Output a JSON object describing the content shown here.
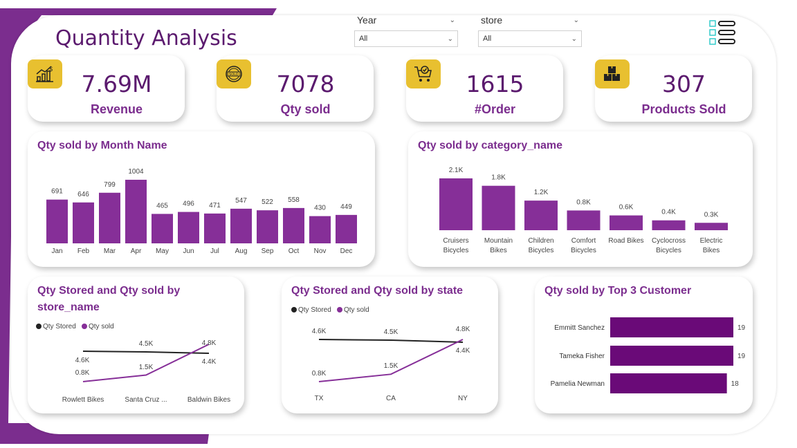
{
  "title": "Quantity Analysis",
  "filters": [
    {
      "label": "Year",
      "value": "All"
    },
    {
      "label": "store",
      "value": "All"
    }
  ],
  "kpis": [
    {
      "value": "7.69M",
      "label": "Revenue",
      "icon": "revenue-chart-icon"
    },
    {
      "value": "7078",
      "label": "Qty sold",
      "icon": "sold-stamp-icon"
    },
    {
      "value": "1615",
      "label": "#Order",
      "icon": "cart-check-icon"
    },
    {
      "value": "307",
      "label": "Products Sold",
      "icon": "boxes-icon"
    }
  ],
  "colors": {
    "accent": "#7b2d8e",
    "dark_purple": "#5b1a6e",
    "bar_purple": "#862f98",
    "customer_bar": "#6a0a78",
    "icon_yellow": "#e8c030",
    "line_black": "#222222"
  },
  "chart_data": [
    {
      "id": "month",
      "type": "bar",
      "title": "Qty sold by Month Name",
      "categories": [
        "Jan",
        "Feb",
        "Mar",
        "Apr",
        "May",
        "Jun",
        "Jul",
        "Aug",
        "Sep",
        "Oct",
        "Nov",
        "Dec"
      ],
      "values": [
        691,
        646,
        799,
        1004,
        465,
        496,
        471,
        547,
        522,
        558,
        430,
        449
      ],
      "data_labels": [
        "691",
        "646",
        "799",
        "1004",
        "465",
        "496",
        "471",
        "547",
        "522",
        "558",
        "430",
        "449"
      ],
      "ylim": [
        0,
        1004
      ]
    },
    {
      "id": "category",
      "type": "bar",
      "title": "Qty sold by category_name",
      "categories": [
        [
          "Cruisers",
          "Bicycles"
        ],
        [
          "Mountain",
          "Bikes"
        ],
        [
          "Children",
          "Bicycles"
        ],
        [
          "Comfort",
          "Bicycles"
        ],
        [
          "Road Bikes"
        ],
        [
          "Cyclocross",
          "Bicycles"
        ],
        [
          "Electric",
          "Bikes"
        ]
      ],
      "values": [
        2100,
        1800,
        1200,
        800,
        600,
        400,
        300
      ],
      "data_labels": [
        "2.1K",
        "1.8K",
        "1.2K",
        "0.8K",
        "0.6K",
        "0.4K",
        "0.3K"
      ],
      "ylim": [
        0,
        2100
      ]
    },
    {
      "id": "store",
      "type": "line",
      "title": "Qty Stored and Qty sold by store_name",
      "legend": [
        "Qty Stored",
        "Qty sold"
      ],
      "categories": [
        "Rowlett Bikes",
        "Santa Cruz ...",
        "Baldwin Bikes"
      ],
      "series": [
        {
          "name": "Qty Stored",
          "values": [
            4600,
            4500,
            4400
          ],
          "labels": [
            "4.6K",
            "4.5K",
            "4.4K"
          ]
        },
        {
          "name": "Qty sold",
          "values": [
            800,
            1500,
            4800
          ],
          "labels": [
            "0.8K",
            "1.5K",
            "4.8K"
          ]
        }
      ]
    },
    {
      "id": "state",
      "type": "line",
      "title": "Qty Stored and Qty sold by state",
      "legend": [
        "Qty Stored",
        "Qty sold"
      ],
      "categories": [
        "TX",
        "CA",
        "NY"
      ],
      "series": [
        {
          "name": "Qty Stored",
          "values": [
            4600,
            4500,
            4400
          ],
          "labels": [
            "4.6K",
            "4.5K",
            "4.4K"
          ]
        },
        {
          "name": "Qty sold",
          "values": [
            800,
            1500,
            4800
          ],
          "labels": [
            "0.8K",
            "1.5K",
            "4.8K"
          ]
        }
      ]
    },
    {
      "id": "customer",
      "type": "bar",
      "orientation": "horizontal",
      "title": "Qty sold by Top 3 Customer",
      "categories": [
        "Emmitt Sanchez",
        "Tameka Fisher",
        "Pamelia Newman"
      ],
      "values": [
        19,
        19,
        18
      ],
      "data_labels": [
        "19",
        "19",
        "18"
      ],
      "ylim": [
        0,
        19
      ]
    }
  ]
}
